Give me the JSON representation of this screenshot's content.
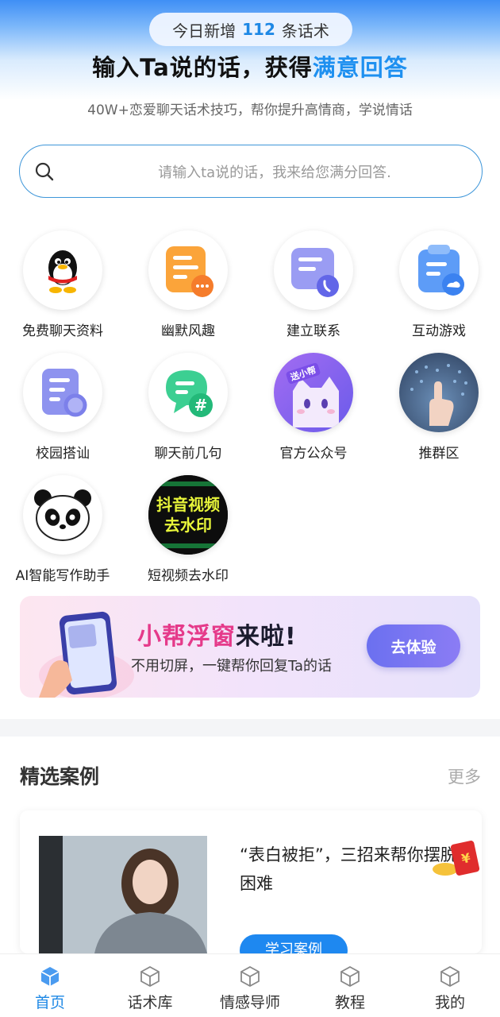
{
  "header": {
    "today_prefix": "今日新增",
    "today_count": "112",
    "today_suffix": "条话术",
    "headline_main": "输入Ta说的话，获得",
    "headline_accent": "满意回答",
    "subline": "40W+恋爱聊天话术技巧，帮你提升高情商，学说情话"
  },
  "search": {
    "placeholder": "请输入ta说的话，我来给您满分回答."
  },
  "tiles": [
    {
      "label": "免费聊天资料",
      "icon": "qq-penguin-icon"
    },
    {
      "label": "幽默风趣",
      "icon": "humor-chat-icon"
    },
    {
      "label": "建立联系",
      "icon": "connect-phone-icon"
    },
    {
      "label": "互动游戏",
      "icon": "game-clipboard-icon"
    },
    {
      "label": "校园搭讪",
      "icon": "campus-doc-icon"
    },
    {
      "label": "聊天前几句",
      "icon": "chat-hashtag-icon"
    },
    {
      "label": "官方公众号",
      "icon": "cat-mascot-icon",
      "badge": "送小帮"
    },
    {
      "label": "推群区",
      "icon": "group-hand-icon"
    },
    {
      "label": "AI智能写作助手",
      "icon": "panda-icon"
    },
    {
      "label": "短视频去水印",
      "icon": "watermark-video-icon",
      "art_line1": "抖音视频",
      "art_line2": "去水印"
    }
  ],
  "banner": {
    "title_pink": "小帮浮窗",
    "title_dark": "来啦!",
    "desc": "不用切屏，一键帮你回复Ta的话",
    "button": "去体验"
  },
  "cases": {
    "section_title": "精选案例",
    "more": "更多",
    "card_title": "“表白被拒”，三招来帮你摆脱困难",
    "card_button": "学习案例"
  },
  "tabbar": {
    "items": [
      {
        "label": "首页",
        "active": true
      },
      {
        "label": "话术库",
        "active": false
      },
      {
        "label": "情感导师",
        "active": false
      },
      {
        "label": "教程",
        "active": false
      },
      {
        "label": "我的",
        "active": false
      }
    ]
  },
  "colors": {
    "accent": "#1e88e5",
    "banner_pink": "#e53a8a",
    "button_purple": "#6b70f0"
  }
}
